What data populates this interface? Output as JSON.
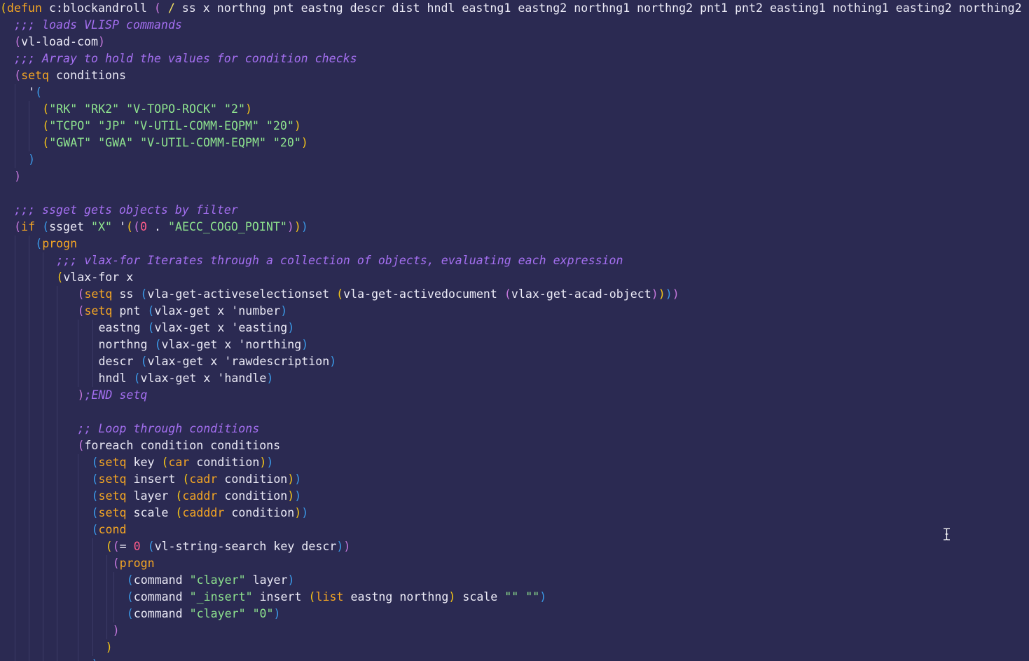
{
  "editor": {
    "background": "#2b2a52",
    "cursor_icon": "text-ibeam-cursor",
    "lines": [
      {
        "indent": 0,
        "tokens": [
          [
            "p1",
            "("
          ],
          [
            "kw",
            "defun"
          ],
          [
            "text",
            " c:blockandroll "
          ],
          [
            "p2",
            "("
          ],
          [
            "text",
            " "
          ],
          [
            "slash",
            "/"
          ],
          [
            "text",
            " ss x northng pnt eastng descr dist hndl eastng1 eastng2 northng1 northng2 pnt1 pnt2 easting1 nothing1 easting2 northing2 "
          ],
          [
            "p2",
            ")"
          ]
        ]
      },
      {
        "indent": 2,
        "tokens": [
          [
            "com",
            ";;; loads VLISP commands"
          ]
        ]
      },
      {
        "indent": 2,
        "tokens": [
          [
            "p2",
            "("
          ],
          [
            "text",
            "vl-load-com"
          ],
          [
            "p2",
            ")"
          ]
        ]
      },
      {
        "indent": 2,
        "tokens": [
          [
            "com",
            ";;; Array to hold the values for condition checks"
          ]
        ]
      },
      {
        "indent": 2,
        "tokens": [
          [
            "p2",
            "("
          ],
          [
            "kw",
            "setq"
          ],
          [
            "text",
            " conditions"
          ]
        ]
      },
      {
        "indent": 4,
        "tokens": [
          [
            "q",
            "'"
          ],
          [
            "p3",
            "("
          ]
        ]
      },
      {
        "indent": 6,
        "tokens": [
          [
            "p1",
            "("
          ],
          [
            "str",
            "\"RK\" \"RK2\" \"V-TOPO-ROCK\" \"2\""
          ],
          [
            "p1",
            ")"
          ]
        ]
      },
      {
        "indent": 6,
        "tokens": [
          [
            "p1",
            "("
          ],
          [
            "str",
            "\"TCPO\" \"JP\" \"V-UTIL-COMM-EQPM\" \"20\""
          ],
          [
            "p1",
            ")"
          ]
        ]
      },
      {
        "indent": 6,
        "tokens": [
          [
            "p1",
            "("
          ],
          [
            "str",
            "\"GWAT\" \"GWA\" \"V-UTIL-COMM-EQPM\" \"20\""
          ],
          [
            "p1",
            ")"
          ]
        ]
      },
      {
        "indent": 4,
        "tokens": [
          [
            "p3",
            ")"
          ]
        ]
      },
      {
        "indent": 2,
        "tokens": [
          [
            "p2",
            ")"
          ]
        ]
      },
      {
        "indent": 0,
        "tokens": []
      },
      {
        "indent": 2,
        "tokens": [
          [
            "com",
            ";;; ssget gets objects by filter"
          ]
        ]
      },
      {
        "indent": 2,
        "tokens": [
          [
            "p2",
            "("
          ],
          [
            "kw",
            "if"
          ],
          [
            "text",
            " "
          ],
          [
            "p3",
            "("
          ],
          [
            "text",
            "ssget "
          ],
          [
            "str",
            "\"X\""
          ],
          [
            "text",
            " '"
          ],
          [
            "p1",
            "("
          ],
          [
            "p2",
            "("
          ],
          [
            "num",
            "0"
          ],
          [
            "text",
            " . "
          ],
          [
            "str",
            "\"AECC_COGO_POINT\""
          ],
          [
            "p2",
            ")"
          ],
          [
            "p1",
            ")"
          ],
          [
            "p3",
            ")"
          ]
        ]
      },
      {
        "indent": 5,
        "tokens": [
          [
            "p3",
            "("
          ],
          [
            "kw",
            "progn"
          ]
        ]
      },
      {
        "indent": 8,
        "tokens": [
          [
            "com",
            ";;; vlax-for Iterates through a collection of objects, evaluating each expression"
          ]
        ]
      },
      {
        "indent": 8,
        "tokens": [
          [
            "p1",
            "("
          ],
          [
            "text",
            "vlax-for x"
          ]
        ]
      },
      {
        "indent": 11,
        "tokens": [
          [
            "p2",
            "("
          ],
          [
            "kw",
            "setq"
          ],
          [
            "text",
            " ss "
          ],
          [
            "p3",
            "("
          ],
          [
            "text",
            "vla-get-activeselectionset "
          ],
          [
            "p1",
            "("
          ],
          [
            "text",
            "vla-get-activedocument "
          ],
          [
            "p2",
            "("
          ],
          [
            "text",
            "vlax-get-acad-object"
          ],
          [
            "p2",
            ")"
          ],
          [
            "p1",
            ")"
          ],
          [
            "p3",
            ")"
          ],
          [
            "p2",
            ")"
          ]
        ]
      },
      {
        "indent": 11,
        "tokens": [
          [
            "p2",
            "("
          ],
          [
            "kw",
            "setq"
          ],
          [
            "text",
            " pnt "
          ],
          [
            "p3",
            "("
          ],
          [
            "text",
            "vlax-get x 'number"
          ],
          [
            "p3",
            ")"
          ]
        ]
      },
      {
        "indent": 14,
        "tokens": [
          [
            "text",
            "eastng "
          ],
          [
            "p3",
            "("
          ],
          [
            "text",
            "vlax-get x 'easting"
          ],
          [
            "p3",
            ")"
          ]
        ]
      },
      {
        "indent": 14,
        "tokens": [
          [
            "text",
            "northng "
          ],
          [
            "p3",
            "("
          ],
          [
            "text",
            "vlax-get x 'northing"
          ],
          [
            "p3",
            ")"
          ]
        ]
      },
      {
        "indent": 14,
        "tokens": [
          [
            "text",
            "descr "
          ],
          [
            "p3",
            "("
          ],
          [
            "text",
            "vlax-get x 'rawdescription"
          ],
          [
            "p3",
            ")"
          ]
        ]
      },
      {
        "indent": 14,
        "tokens": [
          [
            "text",
            "hndl "
          ],
          [
            "p3",
            "("
          ],
          [
            "text",
            "vlax-get x 'handle"
          ],
          [
            "p3",
            ")"
          ]
        ]
      },
      {
        "indent": 11,
        "tokens": [
          [
            "p2",
            ")"
          ],
          [
            "com",
            ";END setq"
          ]
        ]
      },
      {
        "indent": 0,
        "tokens": []
      },
      {
        "indent": 11,
        "tokens": [
          [
            "com",
            ";; Loop through conditions"
          ]
        ]
      },
      {
        "indent": 11,
        "tokens": [
          [
            "p2",
            "("
          ],
          [
            "text",
            "foreach condition conditions"
          ]
        ]
      },
      {
        "indent": 13,
        "tokens": [
          [
            "p3",
            "("
          ],
          [
            "kw",
            "setq"
          ],
          [
            "text",
            " key "
          ],
          [
            "p1",
            "("
          ],
          [
            "kw",
            "car"
          ],
          [
            "text",
            " condition"
          ],
          [
            "p1",
            ")"
          ],
          [
            "p3",
            ")"
          ]
        ]
      },
      {
        "indent": 13,
        "tokens": [
          [
            "p3",
            "("
          ],
          [
            "kw",
            "setq"
          ],
          [
            "text",
            " insert "
          ],
          [
            "p1",
            "("
          ],
          [
            "kw",
            "cadr"
          ],
          [
            "text",
            " condition"
          ],
          [
            "p1",
            ")"
          ],
          [
            "p3",
            ")"
          ]
        ]
      },
      {
        "indent": 13,
        "tokens": [
          [
            "p3",
            "("
          ],
          [
            "kw",
            "setq"
          ],
          [
            "text",
            " layer "
          ],
          [
            "p1",
            "("
          ],
          [
            "kw",
            "caddr"
          ],
          [
            "text",
            " condition"
          ],
          [
            "p1",
            ")"
          ],
          [
            "p3",
            ")"
          ]
        ]
      },
      {
        "indent": 13,
        "tokens": [
          [
            "p3",
            "("
          ],
          [
            "kw",
            "setq"
          ],
          [
            "text",
            " scale "
          ],
          [
            "p1",
            "("
          ],
          [
            "kw",
            "cadddr"
          ],
          [
            "text",
            " condition"
          ],
          [
            "p1",
            ")"
          ],
          [
            "p3",
            ")"
          ]
        ]
      },
      {
        "indent": 13,
        "tokens": [
          [
            "p3",
            "("
          ],
          [
            "kw",
            "cond"
          ]
        ]
      },
      {
        "indent": 15,
        "tokens": [
          [
            "p1",
            "("
          ],
          [
            "p2",
            "("
          ],
          [
            "text",
            "= "
          ],
          [
            "num",
            "0"
          ],
          [
            "text",
            " "
          ],
          [
            "p3",
            "("
          ],
          [
            "text",
            "vl-string-search key descr"
          ],
          [
            "p3",
            ")"
          ],
          [
            "p2",
            ")"
          ]
        ]
      },
      {
        "indent": 16,
        "tokens": [
          [
            "p2",
            "("
          ],
          [
            "kw",
            "progn"
          ]
        ]
      },
      {
        "indent": 18,
        "tokens": [
          [
            "p3",
            "("
          ],
          [
            "text",
            "command "
          ],
          [
            "str",
            "\"clayer\""
          ],
          [
            "text",
            " layer"
          ],
          [
            "p3",
            ")"
          ]
        ]
      },
      {
        "indent": 18,
        "tokens": [
          [
            "p3",
            "("
          ],
          [
            "text",
            "command "
          ],
          [
            "str",
            "\"_insert\""
          ],
          [
            "text",
            " insert "
          ],
          [
            "p1",
            "("
          ],
          [
            "kw",
            "list"
          ],
          [
            "text",
            " eastng northng"
          ],
          [
            "p1",
            ")"
          ],
          [
            "text",
            " scale "
          ],
          [
            "str",
            "\"\" \"\""
          ],
          [
            "p3",
            ")"
          ]
        ]
      },
      {
        "indent": 18,
        "tokens": [
          [
            "p3",
            "("
          ],
          [
            "text",
            "command "
          ],
          [
            "str",
            "\"clayer\" \"0\""
          ],
          [
            "p3",
            ")"
          ]
        ]
      },
      {
        "indent": 16,
        "tokens": [
          [
            "p2",
            ")"
          ]
        ]
      },
      {
        "indent": 15,
        "tokens": [
          [
            "p1",
            ")"
          ]
        ]
      },
      {
        "indent": 13,
        "tokens": [
          [
            "p3",
            ")"
          ]
        ]
      }
    ]
  }
}
